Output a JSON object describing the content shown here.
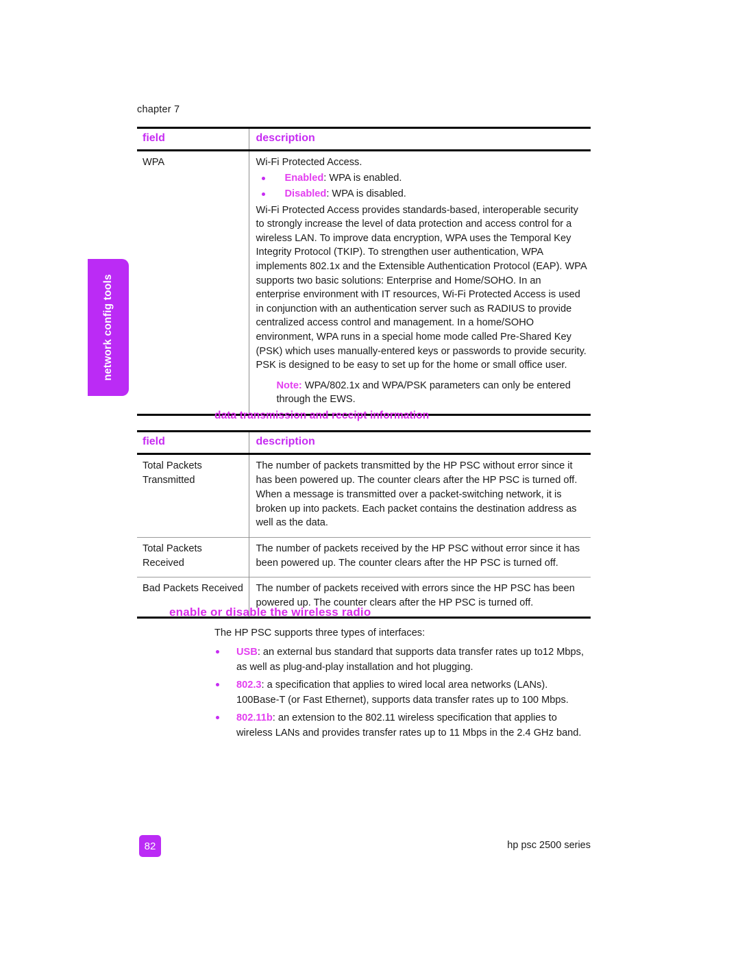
{
  "page": {
    "chapter_label": "chapter 7",
    "side_tab_label": "network config tools",
    "page_number": "82",
    "product_footer": "hp psc 2500 series",
    "accent_color": "#bb2bf5",
    "heading_color": "#d82bea",
    "keyword_color": "#e33ff0"
  },
  "table_wpa": {
    "headers": {
      "field": "field",
      "description": "description"
    },
    "row": {
      "field": "WPA",
      "intro": "Wi-Fi Protected Access.",
      "bullets": [
        {
          "term": "Enabled",
          "text": ": WPA is enabled."
        },
        {
          "term": "Disabled",
          "text": ": WPA is disabled."
        }
      ],
      "paragraph": "Wi-Fi Protected Access provides standards-based, interoperable security to strongly increase the level of data protection and access control for a wireless LAN. To improve data encryption, WPA uses the Temporal Key Integrity Protocol (TKIP). To strengthen user authentication, WPA implements 802.1x and the Extensible Authentication Protocol (EAP). WPA supports two basic solutions: Enterprise and Home/SOHO. In an enterprise environment with IT resources, Wi-Fi Protected Access is used in conjunction with an authentication server such as RADIUS to provide centralized access control and management. In a home/SOHO environment, WPA runs in a special home mode called Pre-Shared Key (PSK) which uses manually-entered keys or passwords to provide security. PSK is designed to be easy to set up for the home or small office user.",
      "note_label": "Note:",
      "note_text": "WPA/802.1x and WPA/PSK parameters can only be entered through the EWS."
    }
  },
  "section_data_transmission": {
    "heading": "data transmission and receipt information",
    "headers": {
      "field": "field",
      "description": "description"
    },
    "rows": [
      {
        "field": "Total Packets\nTransmitted",
        "paragraphs": [
          "The number of packets transmitted by the HP PSC without error since it has been powered up. The counter clears after the HP PSC is turned off.",
          "When a message is transmitted over a packet-switching network, it is broken up into packets. Each packet contains the destination address as well as the data."
        ]
      },
      {
        "field": "Total Packets Received",
        "paragraphs": [
          "The number of packets received by the HP PSC without error since it has been powered up. The counter clears after the HP PSC is turned off."
        ]
      },
      {
        "field": "Bad Packets Received",
        "paragraphs": [
          "The number of packets received with errors since the HP PSC has been powered up. The counter clears after the HP PSC is turned off."
        ]
      }
    ]
  },
  "section_wireless_radio": {
    "heading": "enable or disable the wireless radio",
    "lead": "The HP PSC supports three types of interfaces:",
    "bullets": [
      {
        "term": "USB",
        "text": ": an external bus standard that supports data transfer rates up to12 Mbps, as well as plug-and-play installation and hot plugging."
      },
      {
        "term": "802.3",
        "text": ": a specification that applies to wired local area networks (LANs). 100Base-T (or Fast Ethernet), supports data transfer rates up to 100 Mbps."
      },
      {
        "term": "802.11b",
        "text": ": an extension to the 802.11 wireless specification that applies to wireless LANs and provides transfer rates up to 11 Mbps in the 2.4 GHz band."
      }
    ]
  }
}
